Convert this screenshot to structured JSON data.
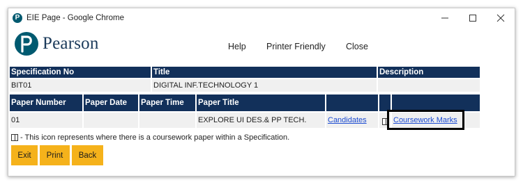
{
  "window": {
    "title": "EIE Page - Google Chrome"
  },
  "header": {
    "logo_text": "Pearson",
    "nav": {
      "help": "Help",
      "printer_friendly": "Printer Friendly",
      "close": "Close"
    }
  },
  "spec_table": {
    "headers": {
      "spec_no": "Specification No",
      "title": "Title",
      "description": "Description"
    },
    "row": {
      "spec_no": "BIT01",
      "title": "DIGITAL INF.TECHNOLOGY 1",
      "description": ""
    }
  },
  "paper_table": {
    "headers": {
      "paper_number": "Paper Number",
      "paper_date": "Paper Date",
      "paper_time": "Paper Time",
      "paper_title": "Paper Title"
    },
    "row": {
      "paper_number": "01",
      "paper_date": "",
      "paper_time": "",
      "paper_title": "EXPLORE UI DES.& PP TECH.",
      "candidates": "Candidates",
      "coursework_marks": "Coursework Marks"
    }
  },
  "note": {
    "text": "- This icon represents where there is a coursework paper within a Specification."
  },
  "buttons": {
    "exit": "Exit",
    "print": "Print",
    "back": "Back"
  },
  "colors": {
    "brand": "#005a70",
    "header_bg": "#12305a",
    "button_bg": "#f5b21b",
    "link": "#1a4ad1"
  }
}
